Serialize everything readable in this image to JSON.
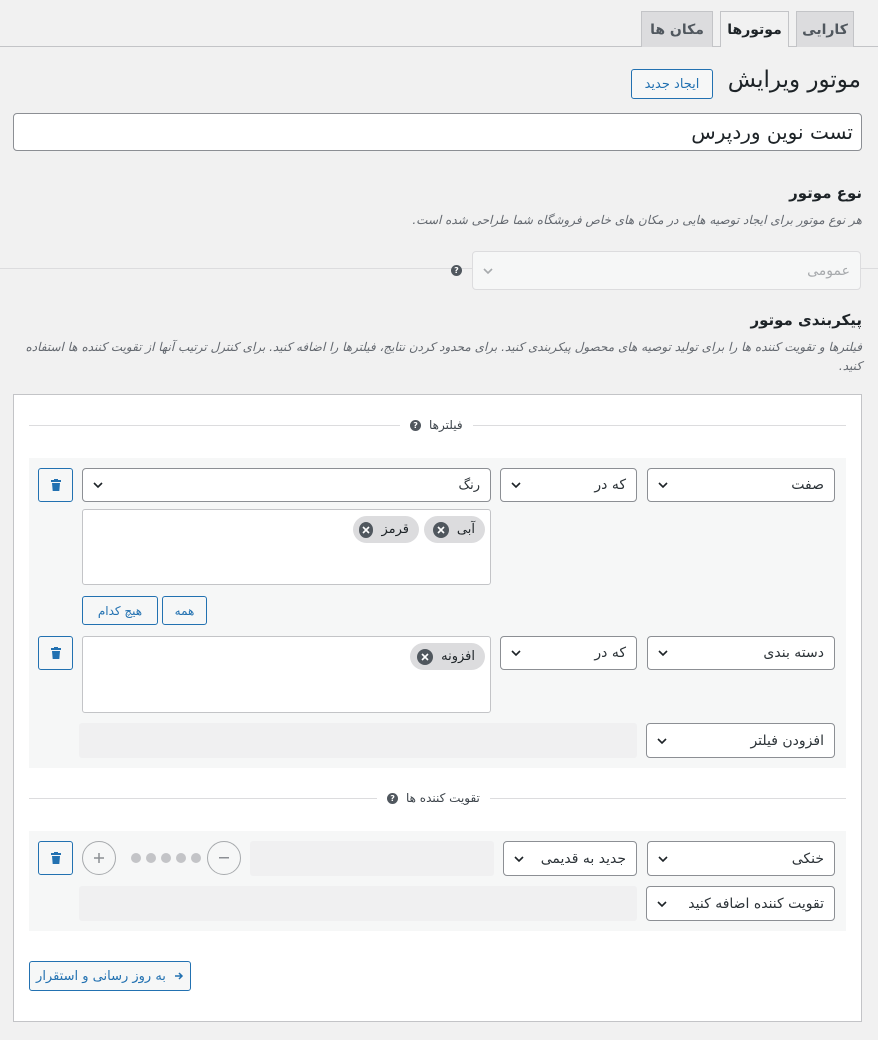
{
  "tabs": [
    {
      "label": "کارایی",
      "active": false
    },
    {
      "label": "موتورها",
      "active": true
    },
    {
      "label": "مکان ها",
      "active": false
    }
  ],
  "header": {
    "title": "موتور ویرایش",
    "new_button": "ایجاد جدید"
  },
  "engine_name": {
    "value": "تست نوین وردپرس"
  },
  "engine_type": {
    "heading": "نوع موتور",
    "description": "هر نوع موتور برای ایجاد توصیه هایی در مکان های خاص فروشگاه شما طراحی شده است.",
    "selected": "عمومی"
  },
  "config": {
    "heading": "پیکربندی موتور",
    "description": "فیلترها و تقویت کننده ها را برای تولید توصیه های محصول پیکربندی کنید. برای محدود کردن نتایج، فیلترها را اضافه کنید. برای کنترل ترتیب آنها از تقویت کننده ها استفاده کنید."
  },
  "filters_section": {
    "label": "فیلترها",
    "rows": [
      {
        "field": "صفت",
        "operator": "که در",
        "value_select": "رنگ",
        "tags": [
          "آبی",
          "قرمز"
        ],
        "all_button": "همه",
        "none_button": "هیچ کدام"
      },
      {
        "field": "دسته بندی",
        "operator": "که در",
        "tags": [
          "افزونه"
        ]
      }
    ],
    "add_filter": "افزودن فیلتر"
  },
  "boosters_section": {
    "label": "تقویت کننده ها",
    "rows": [
      {
        "field": "خنکی",
        "order": "جدید به قدیمی",
        "strength": 0
      }
    ],
    "add_booster": "تقویت کننده اضافه کنید"
  },
  "save_button": "به روز رسانی و استقرار"
}
